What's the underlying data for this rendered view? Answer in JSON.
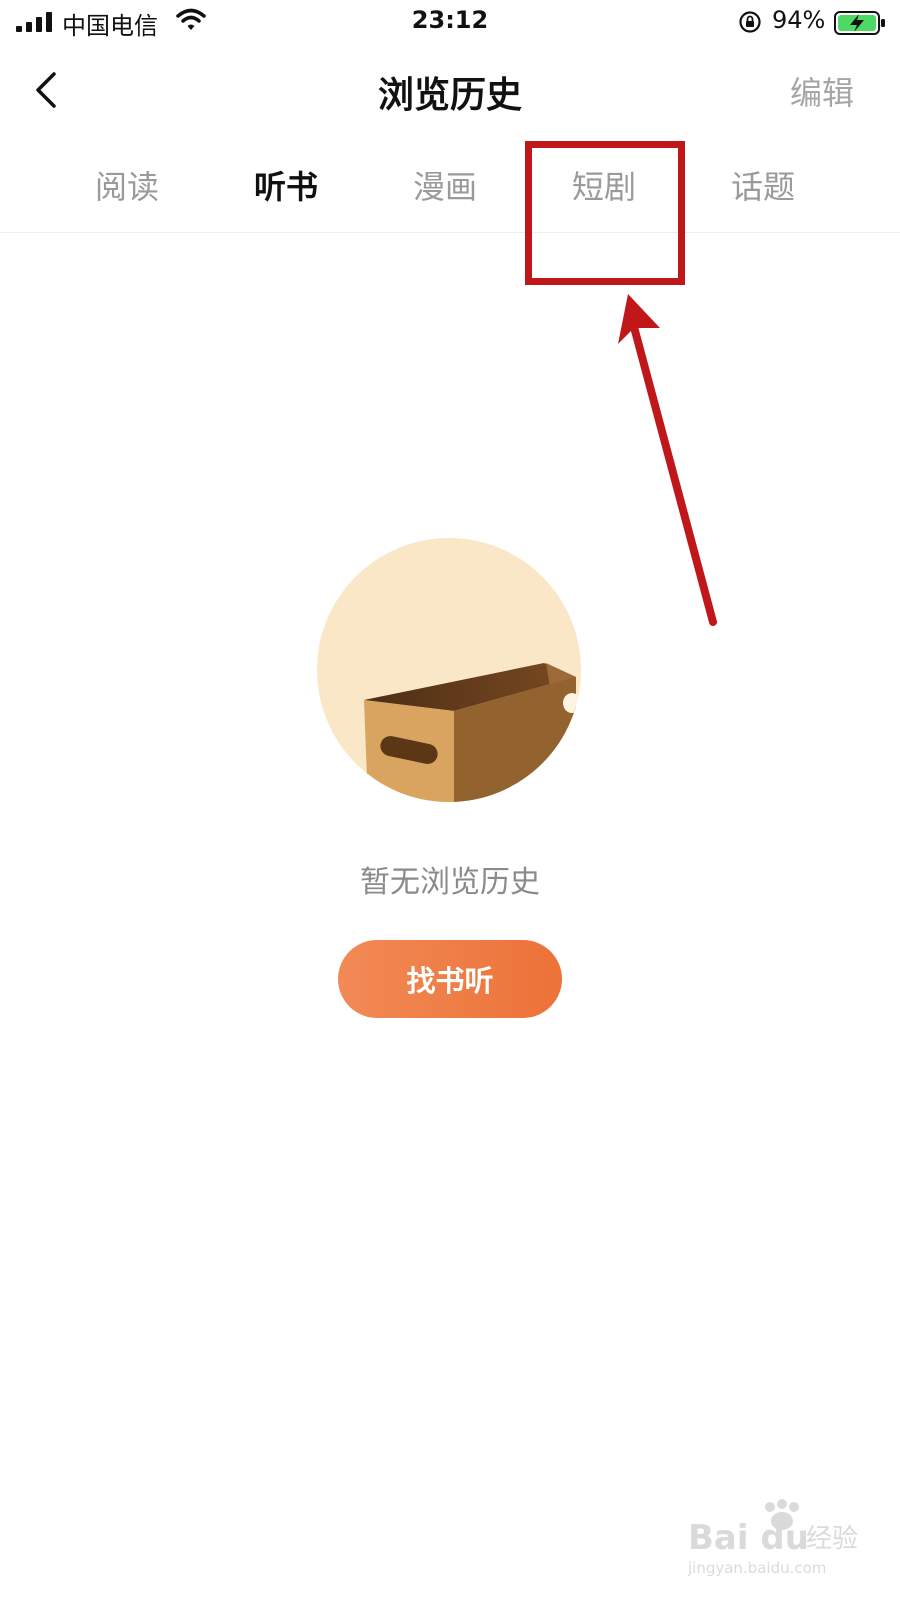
{
  "status_bar": {
    "carrier": "中国电信",
    "time": "23:12",
    "battery_percent": "94%",
    "battery_level": 0.94,
    "icons": [
      "signal-icon",
      "wifi-icon",
      "rotation-lock-icon",
      "battery-charging-icon"
    ]
  },
  "nav": {
    "title": "浏览历史",
    "edit_label": "编辑",
    "back_icon": "chevron-left-icon"
  },
  "tabs": [
    {
      "label": "阅读",
      "active": false
    },
    {
      "label": "听书",
      "active": true
    },
    {
      "label": "漫画",
      "active": false
    },
    {
      "label": "短剧",
      "active": false
    },
    {
      "label": "话题",
      "active": false
    }
  ],
  "empty_state": {
    "illustration": "empty-box-icon",
    "message": "暂无浏览历史",
    "action_label": "找书听"
  },
  "annotation": {
    "target_tab": "短剧",
    "color": "#c0171b"
  },
  "colors": {
    "accent": "#ee7b44",
    "illustration_bg": "#fae7c8",
    "tab_inactive": "#9a9a9a",
    "tab_active": "#111111",
    "battery_green": "#4cd964"
  },
  "watermark": {
    "brand": "Bai du 经验",
    "url": "jingyan.baidu.com"
  }
}
